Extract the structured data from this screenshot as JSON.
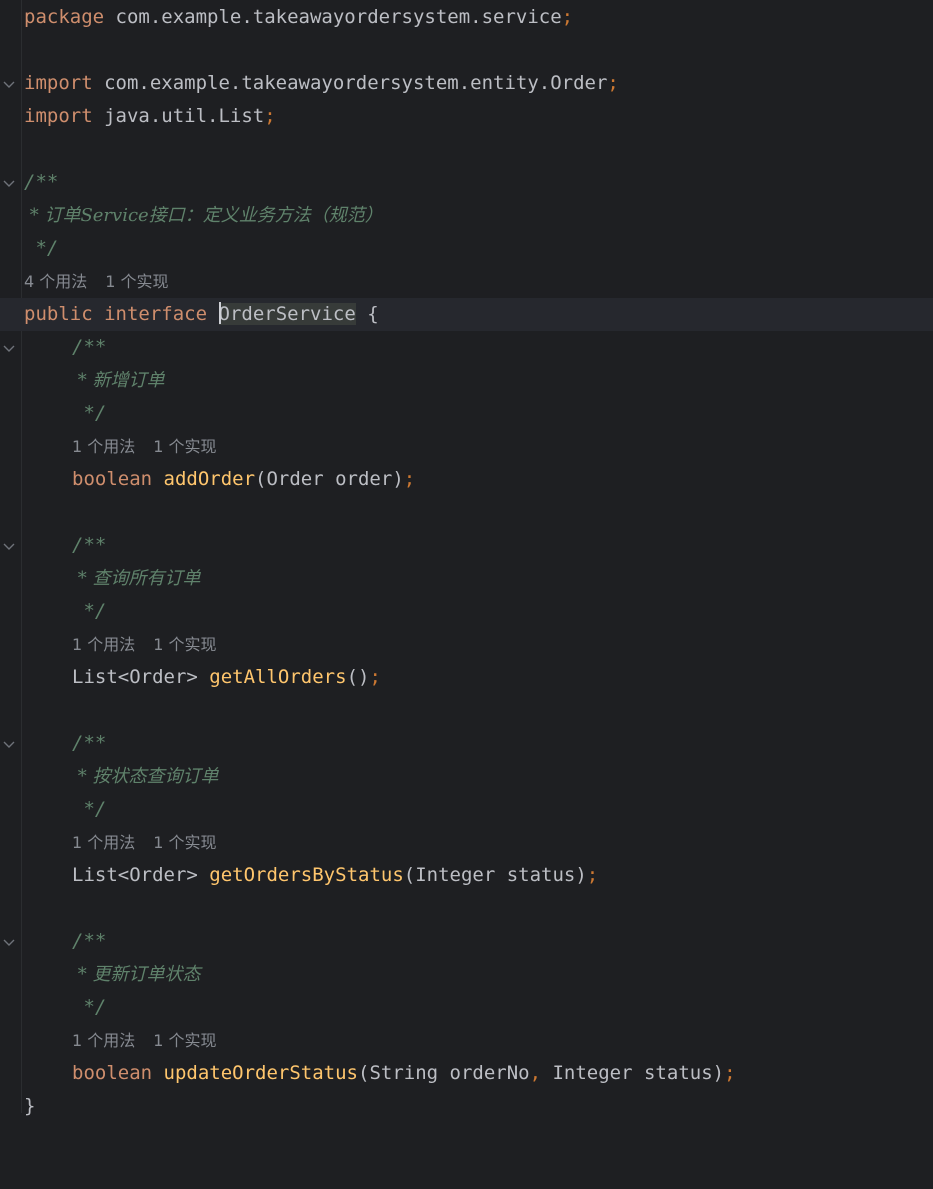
{
  "code": {
    "package_kw": "package",
    "package_name": "com.example.takeawayordersystem.service",
    "import_kw": "import",
    "import1": "com.example.takeawayordersystem.entity.Order",
    "import2": "java.util.List",
    "semicolon": ";",
    "class_doc_open": "/**",
    "class_doc_body": " * 订单Service接口：定义业务方法（规范）",
    "class_doc_close": " */",
    "class_usage": "4 个用法",
    "class_impl": "1 个实现",
    "public_kw": "public",
    "interface_kw": "interface",
    "interface_name": "OrderService",
    "open_brace": "{",
    "close_brace": "}",
    "methods": [
      {
        "doc_open": "/**",
        "doc_body": " * 新增订单",
        "doc_close": " */",
        "usage": "1 个用法",
        "impl": "1 个实现",
        "return_type": "boolean",
        "name": "addOrder",
        "params": "(Order order)"
      },
      {
        "doc_open": "/**",
        "doc_body": " * 查询所有订单",
        "doc_close": " */",
        "usage": "1 个用法",
        "impl": "1 个实现",
        "return_type": "List<Order>",
        "name": "getAllOrders",
        "params": "()"
      },
      {
        "doc_open": "/**",
        "doc_body": " * 按状态查询订单",
        "doc_close": " */",
        "usage": "1 个用法",
        "impl": "1 个实现",
        "return_type": "List<Order>",
        "name": "getOrdersByStatus",
        "params": "(Integer status)"
      },
      {
        "doc_open": "/**",
        "doc_body": " * 更新订单状态",
        "doc_close": " */",
        "usage": "1 个用法",
        "impl": "1 个实现",
        "return_type": "boolean",
        "name": "updateOrderStatus",
        "params_a": "(String orderNo",
        "params_comma": ",",
        "params_b": " Integer status)"
      }
    ]
  },
  "colors": {
    "background": "#1e1f22",
    "keyword": "#cf8e6d",
    "method_decl": "#56a8f5",
    "doc_comment": "#5f826b",
    "inlay_hint": "#868a91",
    "text": "#bcbec4"
  },
  "icons": {
    "fold": "chevron-down-icon"
  }
}
